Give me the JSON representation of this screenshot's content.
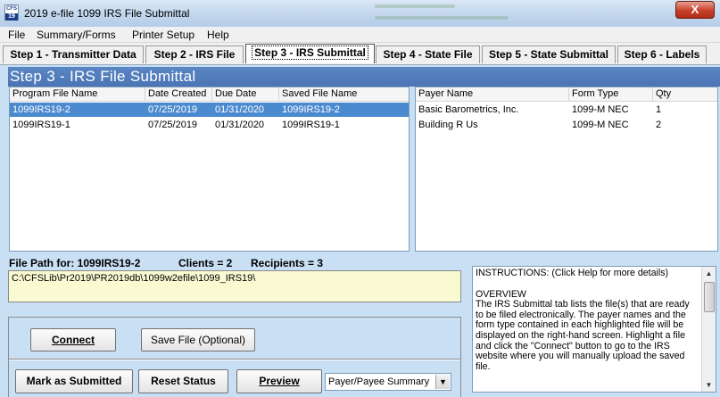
{
  "window": {
    "icon_text": "CFS",
    "icon_number": "19",
    "title": "2019 e-file 1099 IRS File Submittal",
    "close_label": "X"
  },
  "menu": [
    "File",
    "Summary/Forms",
    "Printer Setup",
    "Help"
  ],
  "tabs": [
    "Step 1 - Transmitter Data",
    "Step 2 - IRS File",
    "Step 3 - IRS Submittal",
    "Step 4 - State File",
    "Step 5 - State Submittal",
    "Step 6 - Labels"
  ],
  "active_tab_index": 2,
  "step_title": "Step 3 - IRS File Submittal",
  "files_table": {
    "columns": [
      "Program File Name",
      "Date Created",
      "Due Date",
      "Saved File Name"
    ],
    "rows": [
      [
        "1099IRS19-2",
        "07/25/2019",
        "01/31/2020",
        "1099IRS19-2"
      ],
      [
        "1099IRS19-1",
        "07/25/2019",
        "01/31/2020",
        "1099IRS19-1"
      ]
    ],
    "selected_row": 0
  },
  "payers_table": {
    "columns": [
      "Payer Name",
      "Form Type",
      "Qty"
    ],
    "rows": [
      [
        "Basic Barometrics, Inc.",
        "1099-M NEC",
        "1"
      ],
      [
        "Building R Us",
        "1099-M NEC",
        "2"
      ]
    ]
  },
  "file_path": {
    "label": "File Path for: 1099IRS19-2",
    "clients": "Clients = 2",
    "recipients": "Recipients = 3",
    "value": "C:\\CFSLib\\Pr2019\\PR2019db\\1099w2efile\\1099_IRS19\\"
  },
  "instructions": {
    "header": "INSTRUCTIONS: (Click Help for more details)",
    "subheader": "OVERVIEW",
    "body": "The IRS Submittal tab lists the file(s) that are ready to be filed electronically. The payer names and the form type contained in each highlighted file will be displayed on the right-hand screen.  Highlight a file and click the \"Connect\" button to go to the IRS website where you will manually upload the saved file."
  },
  "buttons": {
    "connect": "Connect",
    "save_file": "Save File (Optional)",
    "mark_submitted": "Mark as Submitted",
    "reset_status": "Reset Status",
    "preview": "Preview"
  },
  "report_select": {
    "value": "Payer/Payee Summary"
  }
}
